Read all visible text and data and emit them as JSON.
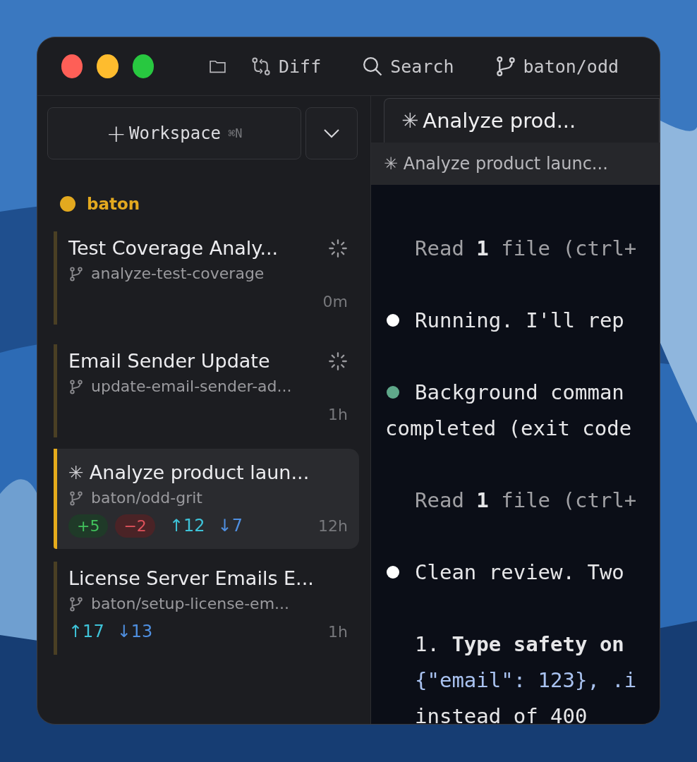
{
  "toolbar": {
    "diff_label": "Diff",
    "search_label": "Search",
    "branch_label": "baton/odd"
  },
  "sidebar": {
    "new_workspace": {
      "icon": "+",
      "label": "Workspace",
      "shortcut": "⌘N"
    },
    "group": {
      "name": "baton",
      "color": "#e3a91f"
    },
    "items": [
      {
        "title": "Test Coverage Analy...",
        "busy": true,
        "branch": "analyze-test-coverage",
        "time": "0m",
        "selected": false
      },
      {
        "title": "Email Sender Update",
        "busy": true,
        "branch": "update-email-sender-ad...",
        "time": "1h",
        "selected": false
      },
      {
        "title": "Analyze product laun...",
        "marker": "✳",
        "busy": false,
        "branch": "baton/odd-grit",
        "added": "+5",
        "removed": "−2",
        "ahead": "↑12",
        "behind": "↓7",
        "time": "12h",
        "selected": true
      },
      {
        "title": "License Server Emails E...",
        "busy": false,
        "branch": "baton/setup-license-em...",
        "ahead": "↑17",
        "behind": "↓13",
        "time": "1h",
        "selected": false
      }
    ]
  },
  "tab": {
    "marker": "✳",
    "label": "Analyze prod..."
  },
  "subtitle": {
    "marker": "✳",
    "label": "Analyze product launc..."
  },
  "terminal": [
    {
      "kind": "dim",
      "text": "Read **1** file (ctrl+"
    },
    {
      "kind": "bullet",
      "color": "#ffffff",
      "text": "Running. I'll rep"
    },
    {
      "kind": "bullet",
      "color": "#5fa88a",
      "text": "Background comman",
      "cont": "completed (exit code"
    },
    {
      "kind": "dim",
      "text": "Read **1** file (ctrl+"
    },
    {
      "kind": "bullet",
      "color": "#ffffff",
      "text": "Clean review. Two"
    },
    {
      "kind": "numbered",
      "text": "1. **Type safety on**"
    },
    {
      "kind": "code",
      "text": "{\"email\": 123}, .i"
    },
    {
      "kind": "plain",
      "text": "instead of 400"
    }
  ]
}
